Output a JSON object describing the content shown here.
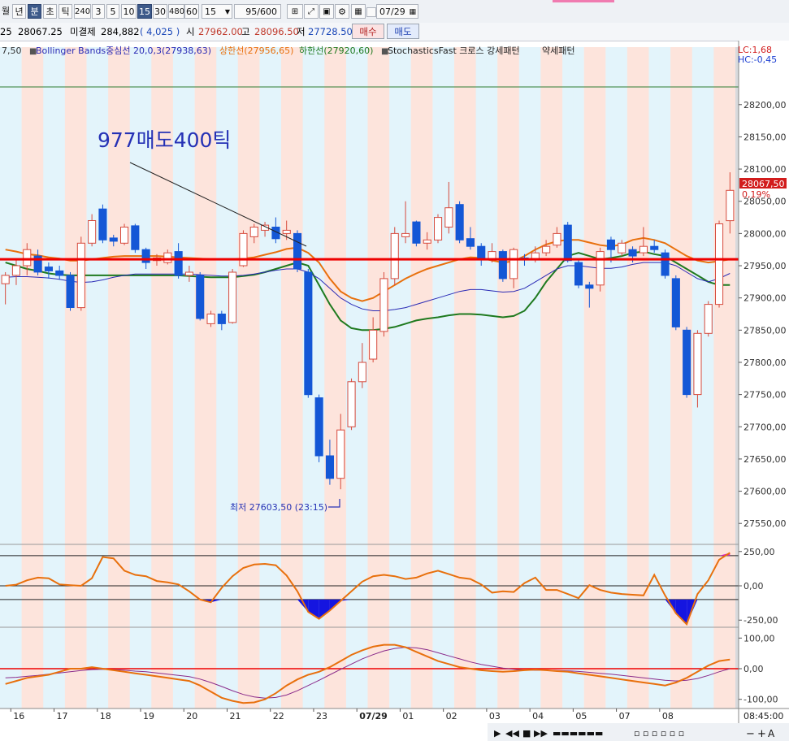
{
  "toolbar": {
    "period_buttons": [
      "월",
      "년",
      "분",
      "초",
      "틱",
      "240",
      "3",
      "5",
      "10",
      "15",
      "30",
      "480",
      "60"
    ],
    "selected_period": "15",
    "interval_value": "15",
    "count_value": "95",
    "count_total": "/600",
    "date_value": "07/29"
  },
  "quote": {
    "prefix": "25",
    "price": "28067.25",
    "oi_label": "미결제",
    "oi_value": "284,882",
    "oi_change": "( 4,025 )",
    "open_label": "시",
    "open": "27962.00",
    "high_label": "고",
    "high": "28096.50",
    "low_label": "저",
    "low": "27728.50",
    "buy_label": "매수",
    "sell_label": "매도"
  },
  "legend": {
    "cut_value": "7,50",
    "bb_label": "Bollinger Bands중심선 20,0,3(27938,63)",
    "upper_label": "상한선(27956,65)",
    "lower_label": "하한선(27920,60)",
    "stoch_label": "StochasticsFast 크로스 강세패턴",
    "weak_label": "약세패턴",
    "lc": "LC:1,68",
    "hc": "HC:-0,45"
  },
  "annotations": {
    "main": "977매도400틱",
    "low_marker": "최저 27603,50 (23:15)"
  },
  "price_tag": {
    "price": "28067,50",
    "pct": "0,19%"
  },
  "colors": {
    "up": "#d64a3c",
    "down": "#1457d6",
    "bb_mid": "#2a2ab5",
    "bb_upper": "#e8700d",
    "bb_lower": "#1f7a1f",
    "hline": "#ee0000",
    "bg_red": "#fde4dc",
    "bg_blue": "#e3f4fb"
  },
  "chart_data": {
    "type": "candlestick",
    "ylim": [
      27520,
      28230
    ],
    "y_ticks": [
      "28200,00",
      "28150,00",
      "28100,00",
      "28050,00",
      "28000,00",
      "27950,00",
      "27900,00",
      "27850,00",
      "27800,00",
      "27750,00",
      "27700,00",
      "27650,00",
      "27600,00",
      "27550,00"
    ],
    "y_tick_values": [
      28200,
      28150,
      28100,
      28050,
      28000,
      27950,
      27900,
      27850,
      27800,
      27750,
      27700,
      27650,
      27600,
      27550
    ],
    "x_labels": [
      {
        "label": "16",
        "i": 1
      },
      {
        "label": "17",
        "i": 5
      },
      {
        "label": "18",
        "i": 9
      },
      {
        "label": "19",
        "i": 13
      },
      {
        "label": "20",
        "i": 17
      },
      {
        "label": "21",
        "i": 21
      },
      {
        "label": "22",
        "i": 25
      },
      {
        "label": "23",
        "i": 29
      },
      {
        "label": "07/29",
        "i": 33
      },
      {
        "label": "01",
        "i": 37
      },
      {
        "label": "02",
        "i": 41
      },
      {
        "label": "03",
        "i": 45
      },
      {
        "label": "04",
        "i": 49
      },
      {
        "label": "05",
        "i": 53
      },
      {
        "label": "07",
        "i": 57
      },
      {
        "label": "08",
        "i": 61
      }
    ],
    "time_label": "08:45:00",
    "horizontal_line": 27960,
    "candles": [
      [
        27922,
        27935,
        27890,
        27940
      ],
      [
        27935,
        27950,
        27920,
        27960
      ],
      [
        27950,
        27975,
        27935,
        27985
      ],
      [
        27965,
        27940,
        27935,
        27975
      ],
      [
        27948,
        27942,
        27930,
        27955
      ],
      [
        27942,
        27935,
        27928,
        27950
      ],
      [
        27935,
        27885,
        27880,
        27940
      ],
      [
        27885,
        27985,
        27880,
        27995
      ],
      [
        27985,
        28020,
        27980,
        28030
      ],
      [
        28038,
        27990,
        27985,
        28045
      ],
      [
        27993,
        27988,
        27980,
        27998
      ],
      [
        27985,
        28010,
        27982,
        28015
      ],
      [
        28012,
        27975,
        27970,
        28015
      ],
      [
        27975,
        27955,
        27945,
        27978
      ],
      [
        27958,
        27962,
        27950,
        27968
      ],
      [
        27955,
        27970,
        27952,
        27975
      ],
      [
        27972,
        27935,
        27930,
        27985
      ],
      [
        27935,
        27940,
        27925,
        27950
      ],
      [
        27935,
        27868,
        27865,
        27940
      ],
      [
        27860,
        27875,
        27855,
        27880
      ],
      [
        27875,
        27860,
        27850,
        27880
      ],
      [
        27862,
        27940,
        27860,
        27945
      ],
      [
        27950,
        28000,
        27948,
        28005
      ],
      [
        27995,
        28010,
        27985,
        28015
      ],
      [
        28005,
        28013,
        27995,
        28018
      ],
      [
        28010,
        27992,
        27985,
        28025
      ],
      [
        28000,
        28005,
        27990,
        28020
      ],
      [
        28000,
        27945,
        27940,
        28005
      ],
      [
        27940,
        27750,
        27745,
        27945
      ],
      [
        27745,
        27655,
        27645,
        27750
      ],
      [
        27655,
        27620,
        27610,
        27680
      ],
      [
        27620,
        27695,
        27603,
        27720
      ],
      [
        27700,
        27770,
        27695,
        27775
      ],
      [
        27770,
        27800,
        27760,
        27830
      ],
      [
        27805,
        27850,
        27800,
        27870
      ],
      [
        27848,
        27930,
        27840,
        27940
      ],
      [
        27930,
        28000,
        27920,
        28010
      ],
      [
        27995,
        28000,
        27985,
        28050
      ],
      [
        28018,
        27985,
        27980,
        28020
      ],
      [
        27985,
        27990,
        27975,
        28002
      ],
      [
        27990,
        28025,
        27985,
        28030
      ],
      [
        28010,
        28040,
        28000,
        28080
      ],
      [
        28045,
        27990,
        27985,
        28050
      ],
      [
        27992,
        27980,
        27975,
        28010
      ],
      [
        27980,
        27960,
        27950,
        27985
      ],
      [
        27960,
        27972,
        27955,
        27985
      ],
      [
        27972,
        27930,
        27925,
        27975
      ],
      [
        27930,
        27975,
        27915,
        27978
      ],
      [
        27962,
        27960,
        27950,
        27968
      ],
      [
        27960,
        27970,
        27955,
        27980
      ],
      [
        27970,
        27980,
        27965,
        27990
      ],
      [
        27982,
        28000,
        27978,
        28010
      ],
      [
        28013,
        27958,
        27955,
        28018
      ],
      [
        27955,
        27920,
        27915,
        27960
      ],
      [
        27920,
        27915,
        27885,
        27925
      ],
      [
        27920,
        27972,
        27910,
        27978
      ],
      [
        27990,
        27975,
        27955,
        27995
      ],
      [
        27970,
        27985,
        27965,
        27990
      ],
      [
        27975,
        27965,
        27955,
        27980
      ],
      [
        27970,
        27980,
        27965,
        28010
      ],
      [
        27980,
        27975,
        27970,
        27990
      ],
      [
        27970,
        27935,
        27930,
        27975
      ],
      [
        27930,
        27855,
        27850,
        27935
      ],
      [
        27850,
        27750,
        27745,
        27855
      ],
      [
        27750,
        27845,
        27730,
        27850
      ],
      [
        27845,
        27890,
        27840,
        27895
      ],
      [
        27890,
        28015,
        27885,
        28020
      ],
      [
        28020,
        28067,
        28000,
        28095
      ]
    ],
    "bb_mid": [
      27932,
      27933,
      27933,
      27932,
      27931,
      27929,
      27926,
      27924,
      27925,
      27928,
      27932,
      27935,
      27937,
      27937,
      27937,
      27937,
      27937,
      27937,
      27936,
      27935,
      27934,
      27934,
      27935,
      27937,
      27940,
      27943,
      27945,
      27945,
      27940,
      27930,
      27915,
      27900,
      27890,
      27883,
      27880,
      27880,
      27882,
      27885,
      27890,
      27895,
      27900,
      27905,
      27910,
      27913,
      27913,
      27911,
      27909,
      27910,
      27915,
      27925,
      27935,
      27945,
      27950,
      27950,
      27948,
      27946,
      27946,
      27948,
      27952,
      27955,
      27955,
      27955,
      27950,
      27940,
      27930,
      27925,
      27930,
      27938
    ],
    "bb_upper": [
      27975,
      27972,
      27968,
      27966,
      27963,
      27961,
      27958,
      27958,
      27960,
      27962,
      27964,
      27965,
      27965,
      27965,
      27965,
      27964,
      27963,
      27962,
      27961,
      27960,
      27960,
      27960,
      27961,
      27963,
      27967,
      27971,
      27976,
      27978,
      27970,
      27955,
      27930,
      27910,
      27900,
      27895,
      27900,
      27910,
      27920,
      27930,
      27938,
      27945,
      27950,
      27955,
      27960,
      27963,
      27962,
      27958,
      27955,
      27957,
      27965,
      27975,
      27983,
      27988,
      27990,
      27990,
      27986,
      27982,
      27980,
      27983,
      27990,
      27993,
      27990,
      27985,
      27975,
      27965,
      27958,
      27955,
      27957,
      27960
    ],
    "bb_lower": [
      27955,
      27950,
      27945,
      27942,
      27938,
      27936,
      27935,
      27935,
      27935,
      27935,
      27935,
      27935,
      27935,
      27935,
      27935,
      27935,
      27935,
      27934,
      27933,
      27932,
      27932,
      27932,
      27934,
      27936,
      27940,
      27945,
      27950,
      27955,
      27950,
      27920,
      27890,
      27865,
      27853,
      27850,
      27850,
      27852,
      27855,
      27860,
      27865,
      27868,
      27870,
      27873,
      27875,
      27875,
      27874,
      27872,
      27870,
      27872,
      27880,
      27900,
      27925,
      27945,
      27965,
      27970,
      27965,
      27960,
      27962,
      27965,
      27970,
      27972,
      27968,
      27965,
      27955,
      27945,
      27935,
      27925,
      27920,
      27920
    ],
    "osc_series": [
      {
        "name": "oscillator",
        "ylim": [
          -290,
          290
        ],
        "y_ticks": [
          "250,00",
          "0,00",
          "-250,00"
        ],
        "y_tick_values": [
          250,
          0,
          -250
        ],
        "ref_lines": [
          220,
          0,
          -100
        ],
        "values": [
          0,
          8,
          40,
          60,
          55,
          10,
          5,
          0,
          55,
          210,
          200,
          110,
          80,
          70,
          35,
          25,
          10,
          -40,
          -100,
          -120,
          -15,
          70,
          130,
          155,
          160,
          150,
          75,
          -40,
          -190,
          -240,
          -180,
          -110,
          -40,
          30,
          70,
          80,
          70,
          50,
          60,
          90,
          110,
          85,
          60,
          50,
          10,
          -50,
          -40,
          -45,
          20,
          60,
          -30,
          -30,
          -60,
          -90,
          5,
          -30,
          -50,
          -60,
          -65,
          -70,
          80,
          -70,
          -200,
          -280,
          -60,
          40,
          190,
          240
        ]
      },
      {
        "name": "stochastics",
        "ylim": [
          -130,
          130
        ],
        "y_ticks": [
          "100,00",
          "0,00",
          "-100,00"
        ],
        "y_tick_values": [
          100,
          0,
          -100
        ],
        "ref_lines": [
          0
        ],
        "values": [
          -50,
          -40,
          -30,
          -25,
          -20,
          -10,
          0,
          0,
          5,
          0,
          -5,
          -10,
          -15,
          -20,
          -25,
          -30,
          -35,
          -40,
          -55,
          -75,
          -95,
          -105,
          -112,
          -110,
          -100,
          -80,
          -55,
          -35,
          -20,
          -10,
          5,
          25,
          45,
          60,
          72,
          78,
          78,
          70,
          55,
          40,
          25,
          15,
          5,
          0,
          -5,
          -8,
          -10,
          -8,
          -5,
          -3,
          -5,
          -8,
          -10,
          -15,
          -20,
          -25,
          -30,
          -35,
          -40,
          -45,
          -50,
          -55,
          -45,
          -30,
          -10,
          10,
          25,
          30
        ],
        "signal": [
          -30,
          -28,
          -25,
          -22,
          -18,
          -14,
          -10,
          -6,
          -3,
          -2,
          -3,
          -5,
          -8,
          -10,
          -14,
          -18,
          -22,
          -26,
          -34,
          -45,
          -58,
          -72,
          -84,
          -92,
          -96,
          -94,
          -86,
          -72,
          -55,
          -38,
          -20,
          -2,
          15,
          32,
          46,
          58,
          66,
          70,
          68,
          62,
          52,
          42,
          32,
          22,
          14,
          8,
          2,
          -2,
          -4,
          -5,
          -5,
          -6,
          -7,
          -9,
          -12,
          -15,
          -18,
          -22,
          -26,
          -30,
          -34,
          -38,
          -40,
          -38,
          -32,
          -22,
          -10,
          0
        ]
      }
    ]
  }
}
